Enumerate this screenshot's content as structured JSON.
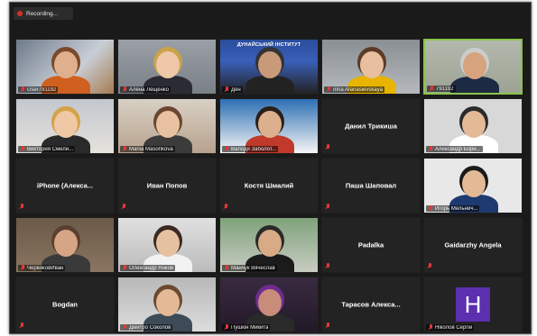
{
  "recording": {
    "label": "Recording..."
  },
  "colors": {
    "active_border": "#8bc34a",
    "muted_mic": "#e53935",
    "avatar_bg": "#5b2fae"
  },
  "tiles": [
    {
      "name": "User791192",
      "video": true
    },
    {
      "name": "Алёна Лещенко",
      "video": true
    },
    {
      "name": "Ден",
      "video": true,
      "banner": "ДУНАЙСЬКИЙ ІНСТИТУТ"
    },
    {
      "name": "Irina Afanasievskaya",
      "video": true
    },
    {
      "name": "791192",
      "video": true,
      "active": true
    },
    {
      "name": "Виктория Смели...",
      "video": true
    },
    {
      "name": "Mariia Masonkova",
      "video": true
    },
    {
      "name": "Валодя Заболот...",
      "video": true
    },
    {
      "center": "Данил Трикиша"
    },
    {
      "name": "Александр Бори...",
      "video": true
    },
    {
      "center": "iPhone  (Алекса..."
    },
    {
      "center": "Иван Попов"
    },
    {
      "center": "Костя Шмалий"
    },
    {
      "center": "Паша Шаповал"
    },
    {
      "name": "Игорь Мельнич...",
      "video": true
    },
    {
      "name": "ЧервяковИван",
      "video": true
    },
    {
      "name": "Олександр Янков",
      "video": true
    },
    {
      "name": "Манчук Вячеслав",
      "video": true
    },
    {
      "center": "Padalka"
    },
    {
      "center": "Gaidarzhy Angela"
    },
    {
      "center": "Bogdan"
    },
    {
      "name": "Дмитро Соколов",
      "video": true
    },
    {
      "name": "Пушкін Микита",
      "video": true
    },
    {
      "center": "Тарасов  Алекса..."
    },
    {
      "name": "Ніколов Сергій",
      "avatar": "H"
    }
  ]
}
